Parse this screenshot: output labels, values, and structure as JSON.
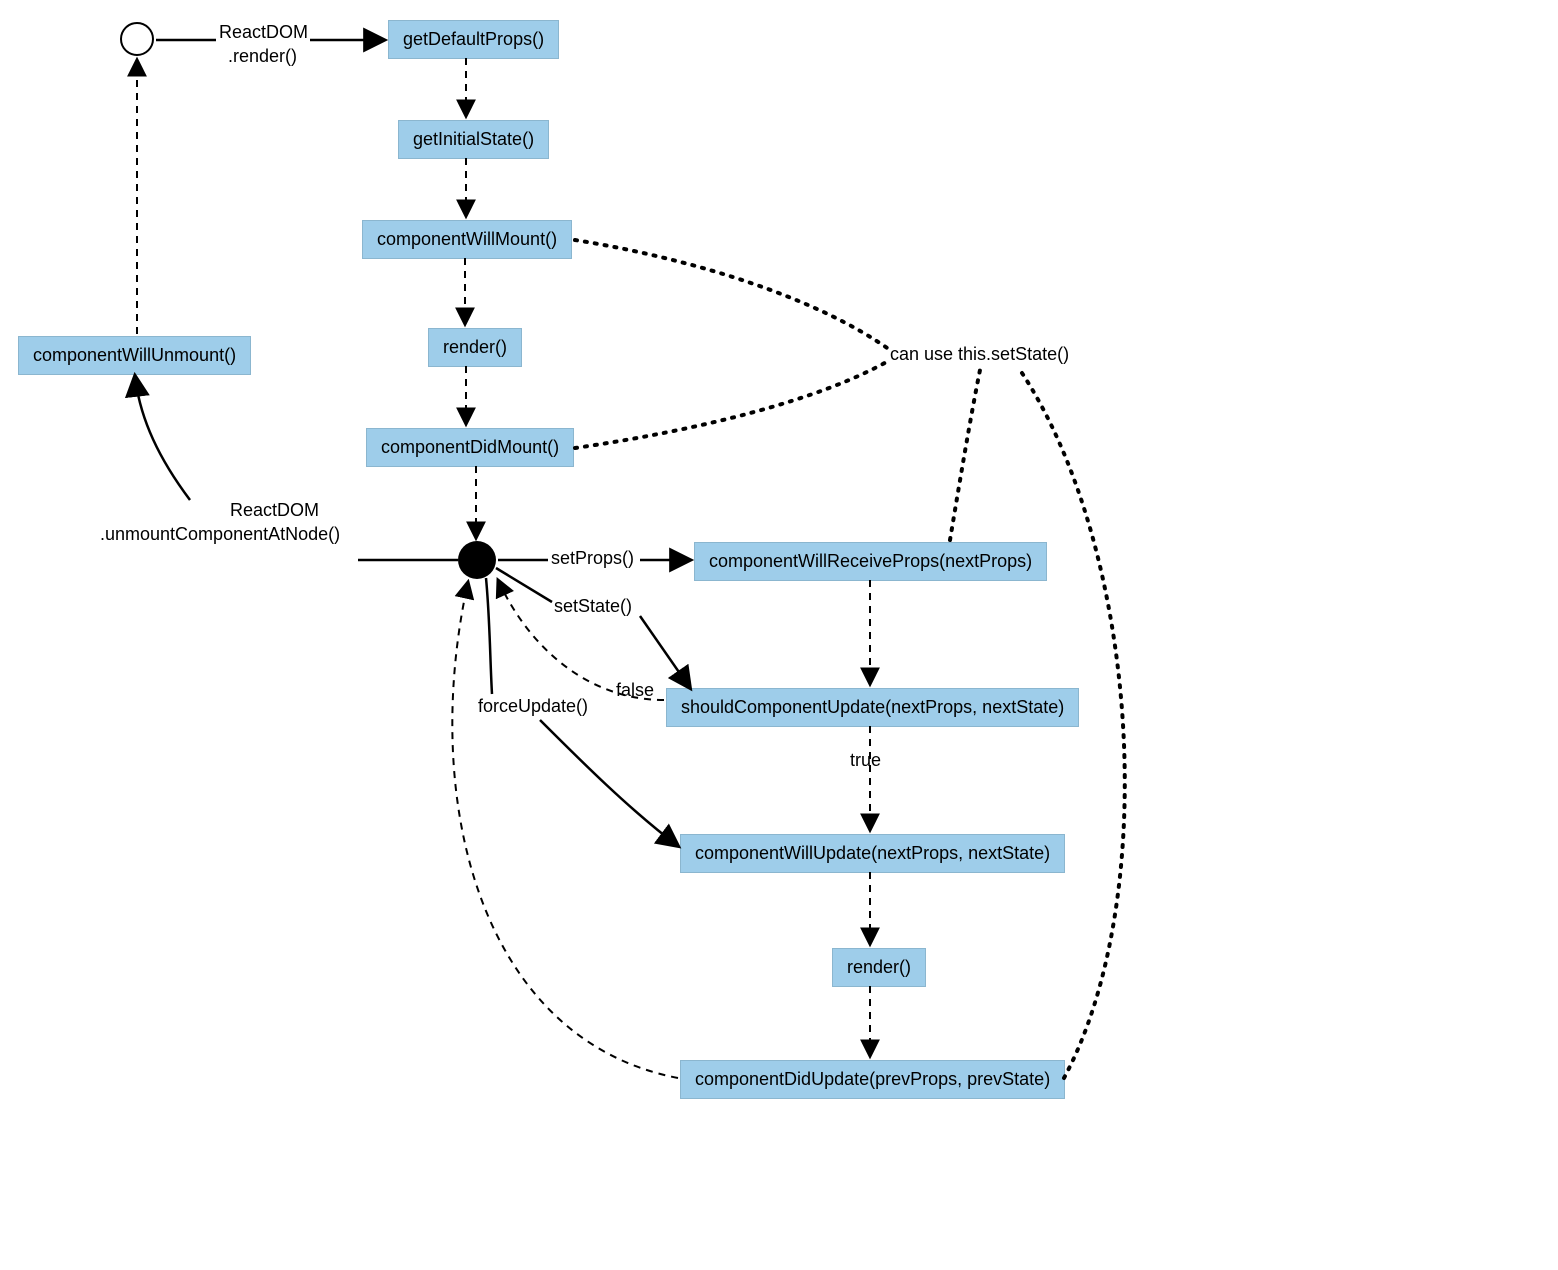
{
  "nodes": {
    "componentWillUnmount": "componentWillUnmount()",
    "getDefaultProps": "getDefaultProps()",
    "getInitialState": "getInitialState()",
    "componentWillMount": "componentWillMount()",
    "render1": "render()",
    "componentDidMount": "componentDidMount()",
    "componentWillReceiveProps": "componentWillReceiveProps(nextProps)",
    "shouldComponentUpdate": "shouldComponentUpdate(nextProps, nextState)",
    "componentWillUpdate": "componentWillUpdate(nextProps, nextState)",
    "render2": "render()",
    "componentDidUpdate": "componentDidUpdate(prevProps, prevState)"
  },
  "labels": {
    "reactDomRender1": "ReactDOM",
    "reactDomRender2": ".render()",
    "canUseSetState": "can use this.setState()",
    "unmount1": "ReactDOM",
    "unmount2": ".unmountComponentAtNode()",
    "setProps": "setProps()",
    "setState": "setState()",
    "forceUpdate": "forceUpdate()",
    "falseLabel": "false",
    "trueLabel": "true"
  }
}
